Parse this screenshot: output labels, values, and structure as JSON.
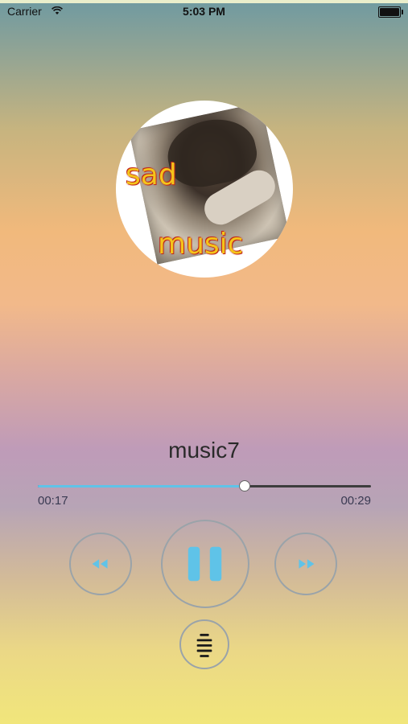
{
  "status_bar": {
    "carrier": "Carrier",
    "time": "5:03 PM"
  },
  "album": {
    "text_line1": "sad",
    "text_line2": "music"
  },
  "track": {
    "title": "music7"
  },
  "progress": {
    "current": "00:17",
    "total": "00:29",
    "fraction": 0.62
  },
  "controls": [
    "rewind-icon",
    "pause-icon",
    "fast-forward-icon",
    "playlist-icon"
  ],
  "colors": {
    "accent": "#5fc3e8",
    "control_ring": "#9aa3a9"
  }
}
